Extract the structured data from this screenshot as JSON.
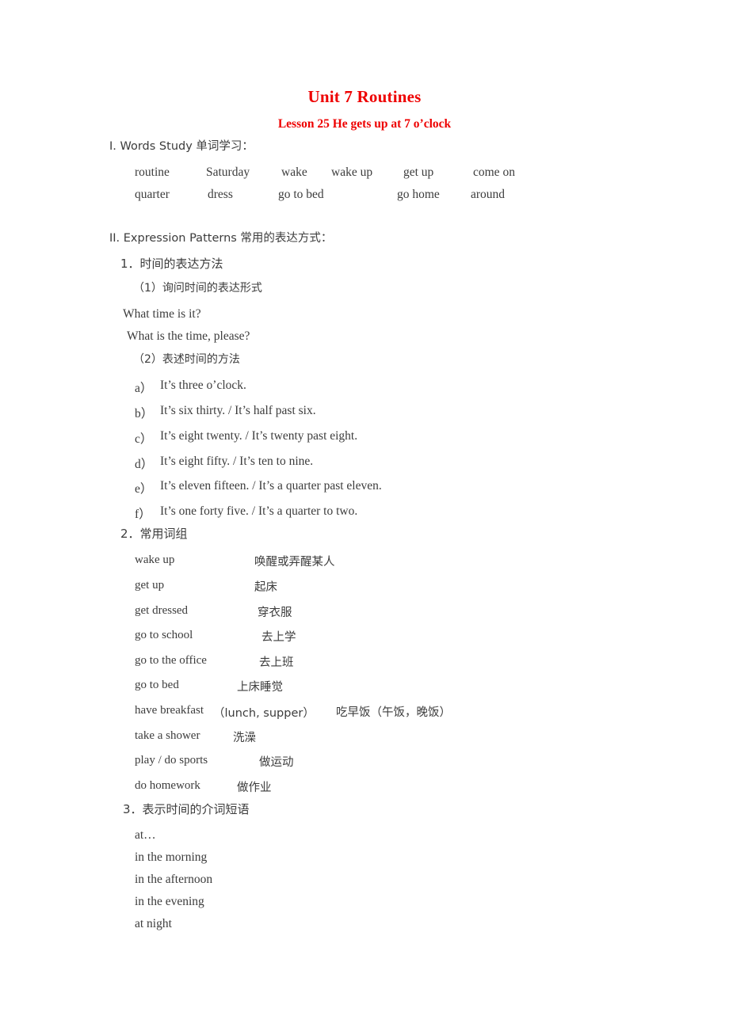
{
  "document": {
    "title": "Unit 7 Routines",
    "subtitle": "Lesson 25  He gets up at 7 o’clock"
  },
  "section_words": {
    "heading": "I. Words Study 单词学习：",
    "rows": [
      [
        "routine",
        "Saturday",
        "wake",
        "wake up",
        "get up",
        "come on"
      ],
      [
        "quarter",
        "dress",
        "go to bed",
        "",
        "go home",
        "around"
      ]
    ]
  },
  "section_patterns": {
    "heading": "II. Expression Patterns 常用的表达方式：",
    "sub1": {
      "heading": "1．时间的表达方法",
      "item1_label": "（1）询问时间的表达形式",
      "question1": "What time is it?",
      "question2": "What is the time, please?",
      "item2_label": "（2）表述时间的方法",
      "examples": [
        {
          "letter": "a）",
          "text": "It’s three o’clock."
        },
        {
          "letter": "b）",
          "text": "It’s six thirty. / It’s half past six."
        },
        {
          "letter": "c）",
          "text": "It’s eight twenty. / It’s twenty past eight."
        },
        {
          "letter": "d）",
          "text": "It’s eight fifty. / It’s ten to nine."
        },
        {
          "letter": "e）",
          "text": "It’s eleven fifteen. / It’s a quarter past eleven."
        },
        {
          "letter": "f）",
          "text": "It’s one forty five. / It’s a quarter to two."
        }
      ]
    },
    "sub2": {
      "heading": "2．常用词组",
      "phrases": [
        {
          "en": "wake up",
          "extra": "",
          "cn": "唤醒或弄醒某人"
        },
        {
          "en": "get up",
          "extra": "",
          "cn": "起床"
        },
        {
          "en": "get dressed",
          "extra": "",
          "cn": "穿衣服"
        },
        {
          "en": "go to school",
          "extra": "",
          "cn": "去上学"
        },
        {
          "en": "go to the office",
          "extra": "",
          "cn": "去上班"
        },
        {
          "en": "go to bed",
          "extra": "",
          "cn": "上床睡觉"
        },
        {
          "en": "have breakfast",
          "extra": "（lunch, supper）",
          "cn": "吃早饭（午饭，晚饭）"
        },
        {
          "en": "take a shower",
          "extra": "",
          "cn": "洗澡"
        },
        {
          "en": "play / do sports",
          "extra": "",
          "cn": "做运动"
        },
        {
          "en": "do homework",
          "extra": "",
          "cn": "做作业"
        }
      ]
    },
    "sub3": {
      "heading": "3．表示时间的介词短语",
      "items": [
        "at…",
        "in the morning",
        "in the afternoon",
        "in the evening",
        "at night"
      ]
    }
  }
}
